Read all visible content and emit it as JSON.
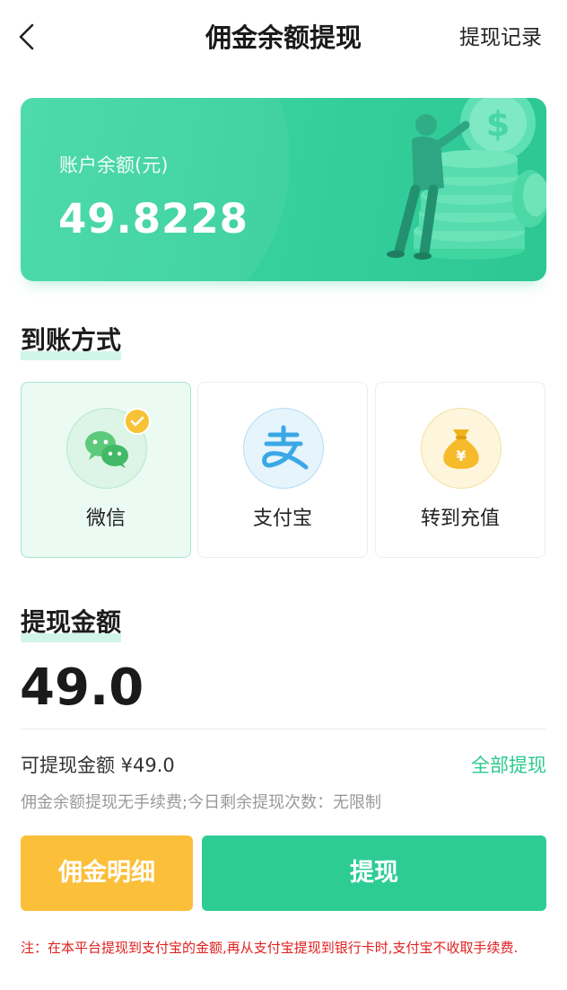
{
  "header": {
    "title": "佣金余额提现",
    "history_link": "提现记录"
  },
  "balance": {
    "label": "账户余额(元)",
    "value": "49.8228"
  },
  "methods_section": {
    "title": "到账方式",
    "options": [
      {
        "label": "微信",
        "icon": "wechat-icon",
        "selected": true
      },
      {
        "label": "支付宝",
        "icon": "alipay-icon",
        "selected": false
      },
      {
        "label": "转到充值",
        "icon": "money-bag-icon",
        "selected": false
      }
    ]
  },
  "amount_section": {
    "title": "提现金额",
    "value": "49.0",
    "available_text": "可提现金额 ¥49.0",
    "all_withdraw": "全部提现",
    "hint": "佣金余额提现无手续费;今日剩余提现次数：无限制"
  },
  "buttons": {
    "detail": "佣金明细",
    "withdraw": "提现"
  },
  "note": "注：在本平台提现到支付宝的金额,再从支付宝提现到银行卡时,支付宝不收取手续费.",
  "colors": {
    "accent": "#2ecc95",
    "secondary": "#fbbf3a",
    "warning_text": "#e02020"
  }
}
